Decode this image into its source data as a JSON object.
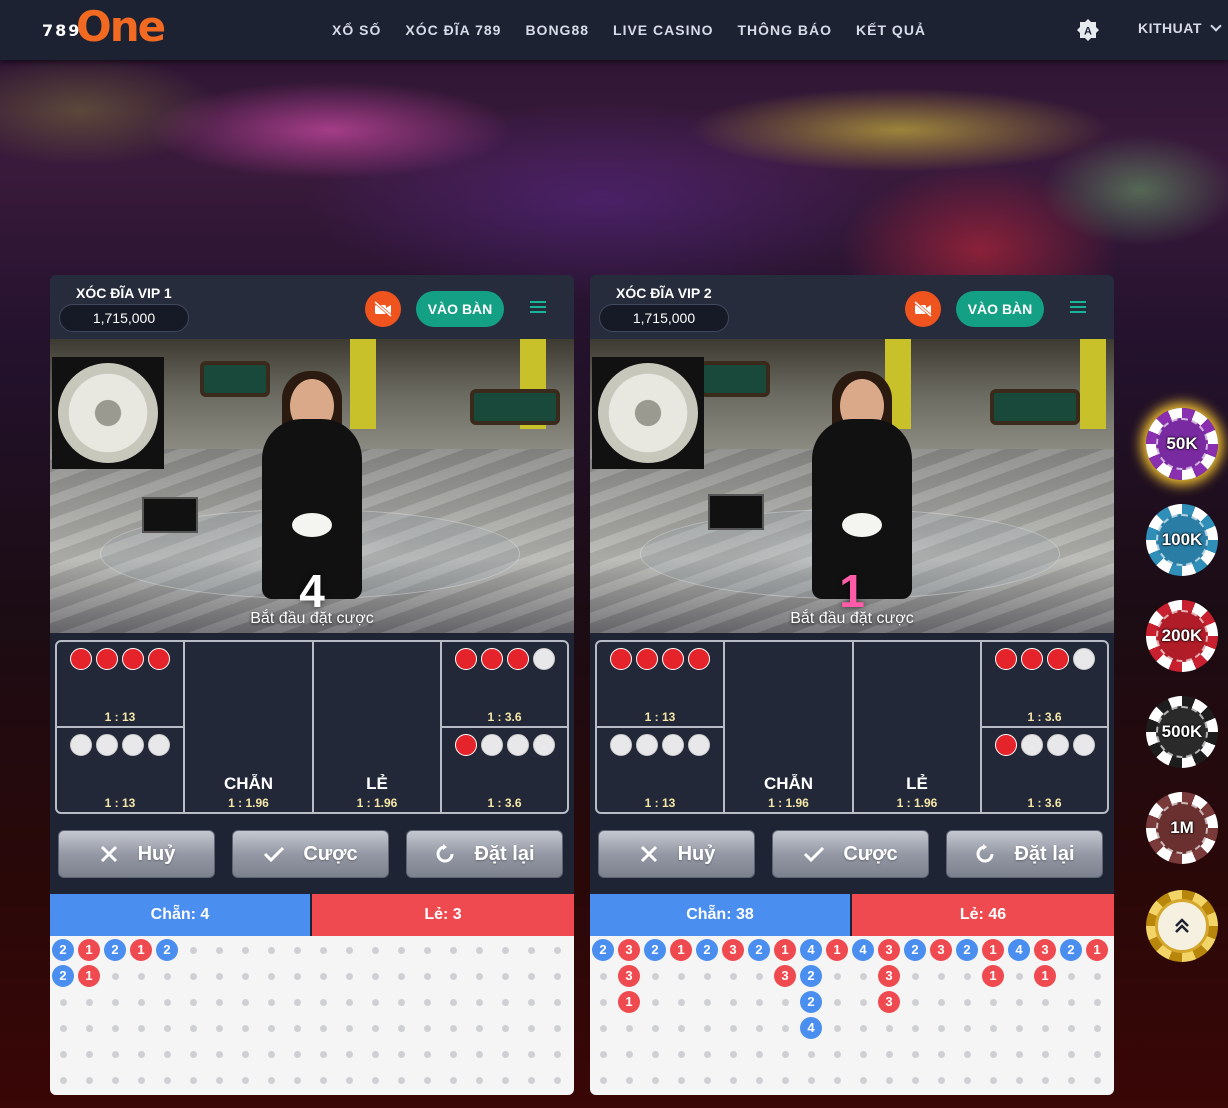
{
  "header": {
    "logo_number": "789",
    "logo_word": "One",
    "nav": [
      "XỔ SỐ",
      "XÓC ĐĨA 789",
      "BONG88",
      "LIVE CASINO",
      "THÔNG BÁO",
      "KẾT QUẢ"
    ],
    "username": "KITHUAT"
  },
  "colors": {
    "header_bg": "#1d2232",
    "brand_orange": "#f26a21",
    "enter_button": "#14a085",
    "camera_button": "#f0541e",
    "even_blue": "#4a8ef0",
    "odd_red": "#ef4a4f",
    "odds_text": "#f5e7a8"
  },
  "tables": [
    {
      "title": "XÓC ĐĨA VIP 1",
      "balance": "1,715,000",
      "enter_label": "VÀO BÀN",
      "countdown": "4",
      "status": "Bắt đầu đặt cược",
      "board": {
        "four_red_odds": "1 : 13",
        "four_white_odds": "1 : 13",
        "even_label": "CHẴN",
        "even_odds": "1 : 1.96",
        "odd_label": "LẺ",
        "odd_odds": "1 : 1.96",
        "three_red_odds": "1 : 3.6",
        "three_white_odds": "1 : 3.6"
      },
      "buttons": {
        "cancel": "Huỷ",
        "bet": "Cược",
        "reset": "Đặt lại"
      },
      "stats": {
        "even": "Chẵn: 4",
        "odd": "Lẻ: 3"
      },
      "road": [
        [
          {
            "v": "2",
            "c": "blue"
          },
          {
            "v": "2",
            "c": "blue"
          }
        ],
        [
          {
            "v": "1",
            "c": "red"
          },
          {
            "v": "1",
            "c": "red"
          }
        ],
        [
          {
            "v": "2",
            "c": "blue"
          }
        ],
        [
          {
            "v": "1",
            "c": "red"
          }
        ],
        [
          {
            "v": "2",
            "c": "blue"
          }
        ]
      ]
    },
    {
      "title": "XÓC ĐĨA VIP 2",
      "balance": "1,715,000",
      "enter_label": "VÀO BÀN",
      "countdown": "1",
      "status": "Bắt đầu đặt cược",
      "board": {
        "four_red_odds": "1 : 13",
        "four_white_odds": "1 : 13",
        "even_label": "CHẴN",
        "even_odds": "1 : 1.96",
        "odd_label": "LẺ",
        "odd_odds": "1 : 1.96",
        "three_red_odds": "1 : 3.6",
        "three_white_odds": "1 : 3.6"
      },
      "buttons": {
        "cancel": "Huỷ",
        "bet": "Cược",
        "reset": "Đặt lại"
      },
      "stats": {
        "even": "Chẵn: 38",
        "odd": "Lẻ: 46"
      },
      "road": [
        [
          {
            "v": "2",
            "c": "blue"
          }
        ],
        [
          {
            "v": "3",
            "c": "red"
          },
          {
            "v": "3",
            "c": "red"
          },
          {
            "v": "1",
            "c": "red"
          }
        ],
        [
          {
            "v": "2",
            "c": "blue"
          }
        ],
        [
          {
            "v": "1",
            "c": "red"
          }
        ],
        [
          {
            "v": "2",
            "c": "blue"
          }
        ],
        [
          {
            "v": "3",
            "c": "red"
          }
        ],
        [
          {
            "v": "2",
            "c": "blue"
          }
        ],
        [
          {
            "v": "1",
            "c": "red"
          },
          {
            "v": "3",
            "c": "red"
          }
        ],
        [
          {
            "v": "4",
            "c": "blue"
          },
          {
            "v": "2",
            "c": "blue"
          },
          {
            "v": "2",
            "c": "blue"
          },
          {
            "v": "4",
            "c": "blue"
          }
        ],
        [
          {
            "v": "1",
            "c": "red"
          }
        ],
        [
          {
            "v": "4",
            "c": "blue"
          }
        ],
        [
          {
            "v": "3",
            "c": "red"
          },
          {
            "v": "3",
            "c": "red"
          },
          {
            "v": "3",
            "c": "red"
          }
        ],
        [
          {
            "v": "2",
            "c": "blue"
          }
        ],
        [
          {
            "v": "3",
            "c": "red"
          }
        ],
        [
          {
            "v": "2",
            "c": "blue"
          }
        ],
        [
          {
            "v": "1",
            "c": "red"
          },
          {
            "v": "1",
            "c": "red"
          }
        ],
        [
          {
            "v": "4",
            "c": "blue"
          }
        ],
        [
          {
            "v": "3",
            "c": "red"
          },
          {
            "v": "1",
            "c": "red"
          }
        ],
        [
          {
            "v": "2",
            "c": "blue"
          }
        ],
        [
          {
            "v": "1",
            "c": "red"
          }
        ]
      ]
    }
  ],
  "chips": [
    {
      "label": "50K",
      "ring": "#8a2fb0",
      "core": "#7a2aa0",
      "selected": true
    },
    {
      "label": "100K",
      "ring": "#2f8fb8",
      "core": "#2a7ea6",
      "selected": false
    },
    {
      "label": "200K",
      "ring": "#c8202e",
      "core": "#b01c28",
      "selected": false
    },
    {
      "label": "500K",
      "ring": "#1d1d1d",
      "core": "#2a2a2a",
      "selected": false
    },
    {
      "label": "1M",
      "ring": "#7a3a3a",
      "core": "#6a3030",
      "selected": false
    }
  ],
  "scroll_top_icon": "double-chevron-up-icon"
}
